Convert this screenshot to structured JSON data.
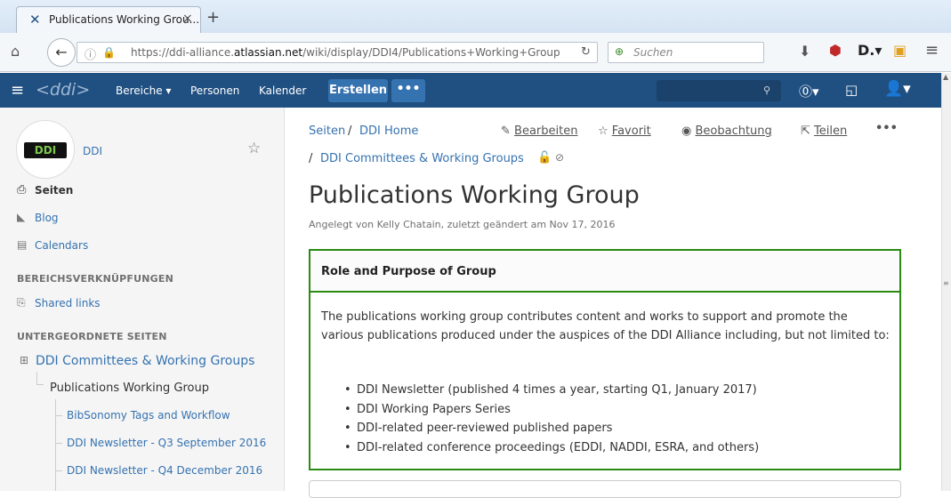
{
  "browser": {
    "tab_title": "Publications Working Grou...",
    "tab_close": "×",
    "new_tab": "+",
    "url_prefix": "https://ddi-alliance.",
    "url_domain": "atlassian.net",
    "url_path": "/wiki/display/DDI4/Publications+Working+Group",
    "search_placeholder": "Suchen"
  },
  "header": {
    "logo": "<ddi>",
    "nav": [
      "Bereiche ▾",
      "Personen",
      "Kalender"
    ],
    "create_label": "Erstellen",
    "more_label": "•••"
  },
  "sidebar": {
    "space_name": "DDI",
    "logo_text": "DDI",
    "main_links": [
      "Seiten",
      "Blog",
      "Calendars"
    ],
    "shortcuts_heading": "BEREICHSVERKNÜPFUNGEN",
    "shared_links": "Shared links",
    "children_heading": "UNTERGEORDNETE SEITEN",
    "tree_parent": "DDI Committees & Working Groups",
    "tree_current": "Publications Working Group",
    "tree_children": [
      "BibSonomy Tags and Workflow",
      "DDI Newsletter - Q3 September 2016",
      "DDI Newsletter - Q4 December 2016"
    ]
  },
  "content": {
    "breadcrumb_1": "Seiten",
    "breadcrumb_sep": "/",
    "breadcrumb_2": "DDI Home",
    "breadcrumb_3": "DDI Committees & Working Groups",
    "actions": {
      "edit": "Bearbeiten",
      "favorite": "Favorit",
      "watch": "Beobachtung",
      "share": "Teilen",
      "more": "•••"
    },
    "title": "Publications Working Group",
    "byline": "Angelegt von Kelly Chatain, zuletzt geändert am Nov 17, 2016",
    "panel": {
      "heading": "Role and Purpose of Group",
      "body": "The publications working group contributes content and works to support and promote the various publications produced under the auspices of the DDI Alliance including, but not limited to:",
      "items": [
        "DDI Newsletter (published 4 times a year, starting Q1, January 2017)",
        "DDI Working Papers Series",
        "DDI-related peer-reviewed published papers",
        "DDI-related conference proceedings (EDDI, NADDI, ESRA, and others)"
      ]
    }
  },
  "colors": {
    "header_bg": "#205081",
    "button_bg": "#3572b0",
    "panel_border": "#2a8a12",
    "link": "#3572b0"
  }
}
